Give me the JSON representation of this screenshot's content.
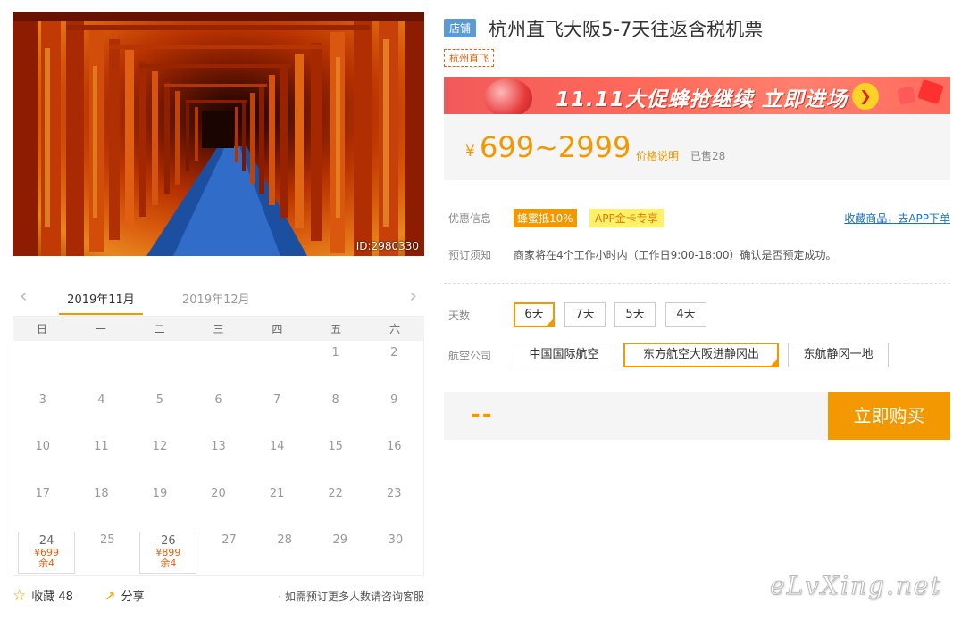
{
  "photo": {
    "id_label": "ID:2980330"
  },
  "calendar": {
    "prev_icon": "chevron-left-icon",
    "next_icon": "chevron-right-icon",
    "active_month": "2019年11月",
    "other_month": "2019年12月",
    "weekdays": [
      "日",
      "一",
      "二",
      "三",
      "四",
      "五",
      "六"
    ],
    "weeks": [
      [
        {
          "d": ""
        },
        {
          "d": ""
        },
        {
          "d": ""
        },
        {
          "d": ""
        },
        {
          "d": ""
        },
        {
          "d": "1"
        },
        {
          "d": "2"
        }
      ],
      [
        {
          "d": "3"
        },
        {
          "d": "4"
        },
        {
          "d": "5"
        },
        {
          "d": "6"
        },
        {
          "d": "7"
        },
        {
          "d": "8"
        },
        {
          "d": "9"
        }
      ],
      [
        {
          "d": "10"
        },
        {
          "d": "11"
        },
        {
          "d": "12"
        },
        {
          "d": "13"
        },
        {
          "d": "14"
        },
        {
          "d": "15"
        },
        {
          "d": "16"
        }
      ],
      [
        {
          "d": "17"
        },
        {
          "d": "18"
        },
        {
          "d": "19"
        },
        {
          "d": "20"
        },
        {
          "d": "21"
        },
        {
          "d": "22"
        },
        {
          "d": "23"
        }
      ],
      [
        {
          "d": "24",
          "price": "¥699",
          "left": "余4"
        },
        {
          "d": "25"
        },
        {
          "d": "26",
          "price": "¥899",
          "left": "余4"
        },
        {
          "d": "27"
        },
        {
          "d": "28"
        },
        {
          "d": "29"
        },
        {
          "d": "30"
        }
      ]
    ]
  },
  "bottom": {
    "fav_label": "收藏 48",
    "share_label": "分享",
    "hint": "· 如需预订更多人数请咨询客服"
  },
  "product": {
    "badge": "店铺",
    "title": "杭州直飞大阪5-7天往返含税机票",
    "tag": "杭州直飞"
  },
  "banner": {
    "text": "11.11大促蜂抢继续 立即进场"
  },
  "price": {
    "currency": "¥",
    "range": "699~2999",
    "explain": "价格说明",
    "sold": "已售28"
  },
  "promo": {
    "label": "优惠信息",
    "tag1": "蜂蜜抵10%",
    "tag2": "APP金卡专享",
    "link": "收藏商品，去APP下单"
  },
  "notice": {
    "label": "预订须知",
    "text": "商家将在4个工作小时内（工作日9:00-18:00）确认是否预定成功。"
  },
  "days": {
    "label": "天数",
    "options": [
      "6天",
      "7天",
      "5天",
      "4天"
    ],
    "selected": 0
  },
  "airline": {
    "label": "航空公司",
    "options": [
      "中国国际航空",
      "东方航空大阪进静冈出",
      "东航静冈一地"
    ],
    "selected": 1
  },
  "buy": {
    "price": "--",
    "button": "立即购买"
  },
  "watermark": "eLvXing.net",
  "colors": {
    "accent": "#f39800",
    "link": "#1a73c8",
    "badge": "#5b9bd5"
  }
}
